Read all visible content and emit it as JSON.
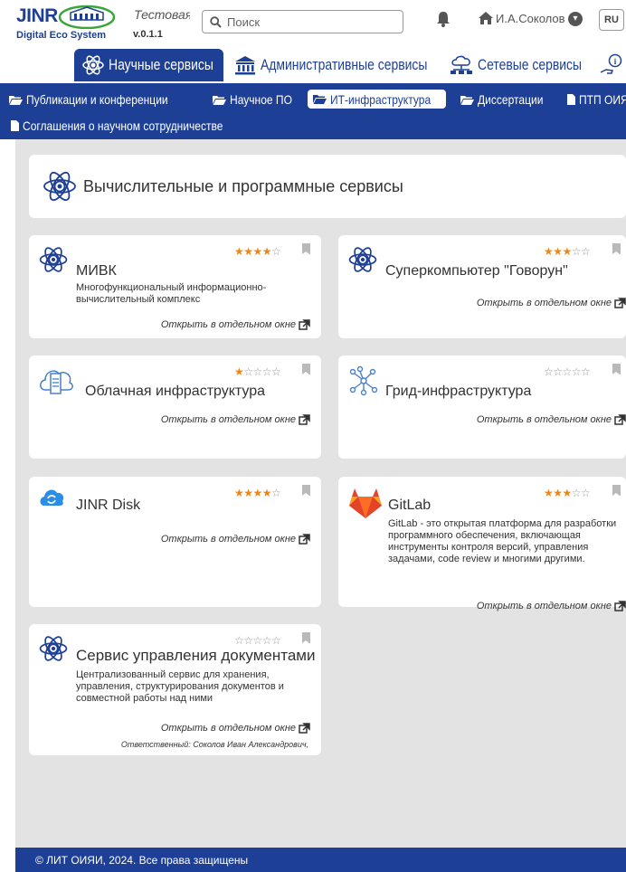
{
  "header": {
    "logo_text": "JINR",
    "logo_subtitle": "Digital Eco System",
    "app_title": "Тестовая",
    "version": "v.0.1.1",
    "search_placeholder": "Поиск",
    "user_name": "И.А.Соколов",
    "language": "RU"
  },
  "main_tabs": [
    {
      "label": "Научные сервисы",
      "active": true
    },
    {
      "label": "Административные сервисы",
      "active": false
    },
    {
      "label": "Сетевые сервисы",
      "active": false
    }
  ],
  "sub_tabs": [
    {
      "label": "Публикации и конференции",
      "icon": "folder-icon",
      "active": false
    },
    {
      "label": "Научное ПО",
      "icon": "folder-icon",
      "active": false
    },
    {
      "label": "ИТ-инфраструктура",
      "icon": "folder-icon",
      "active": true
    },
    {
      "label": "Диссертации",
      "icon": "folder-icon",
      "active": false
    },
    {
      "label": "ПТП ОИЯИ",
      "icon": "file-icon",
      "active": false
    },
    {
      "label": "Соглашения о научном сотрудничестве",
      "icon": "file-icon",
      "active": false
    }
  ],
  "section": {
    "title": "Вычислительные и программные сервисы",
    "icon": "atom-icon"
  },
  "cards": [
    {
      "title": "МИВК",
      "icon": "atom-icon",
      "rating": 4,
      "description": "Многофункциональный информационно-вычислительный комплекс",
      "open_link": "Открыть в отдельном окне"
    },
    {
      "title": "Суперкомпьютер \"Говорун\"",
      "icon": "atom-icon",
      "rating": 3,
      "description": "",
      "open_link": "Открыть в отдельном окне"
    },
    {
      "title": "Облачная инфраструктура",
      "icon": "cloud-server-icon",
      "rating": 1,
      "description": "",
      "open_link": "Открыть в отдельном окне"
    },
    {
      "title": "Грид-инфраструктура",
      "icon": "grid-network-icon",
      "rating": 0,
      "description": "",
      "open_link": "Открыть в отдельном окне"
    },
    {
      "title": "JINR Disk",
      "icon": "jinr-disk-icon",
      "rating": 4,
      "description": "",
      "open_link": "Открыть в отдельном окне"
    },
    {
      "title": "GitLab",
      "icon": "gitlab-icon",
      "rating": 3,
      "description": "GitLab - это открытая платформа для разработки программного обеспечения, включающая инструменты контроля версий, управления задачами, code review и многими другими.",
      "open_link": "Открыть в отдельном окне"
    },
    {
      "title": "Сервис управления документами",
      "icon": "atom-icon",
      "rating": 0,
      "description": "Централизованный сервис для хранения, управления, структурирования документов и совместной работы над ними",
      "open_link": "Открыть в отдельном окне",
      "responsible": "Ответственный: Соколов Иван Александрович,"
    }
  ],
  "footer": {
    "text": "© ЛИТ ОИЯИ, 2024. Все права защищены"
  },
  "colors": {
    "brand_blue": "#1d3f95",
    "star_orange": "#e8871a",
    "content_bg": "#e3e3e3"
  }
}
